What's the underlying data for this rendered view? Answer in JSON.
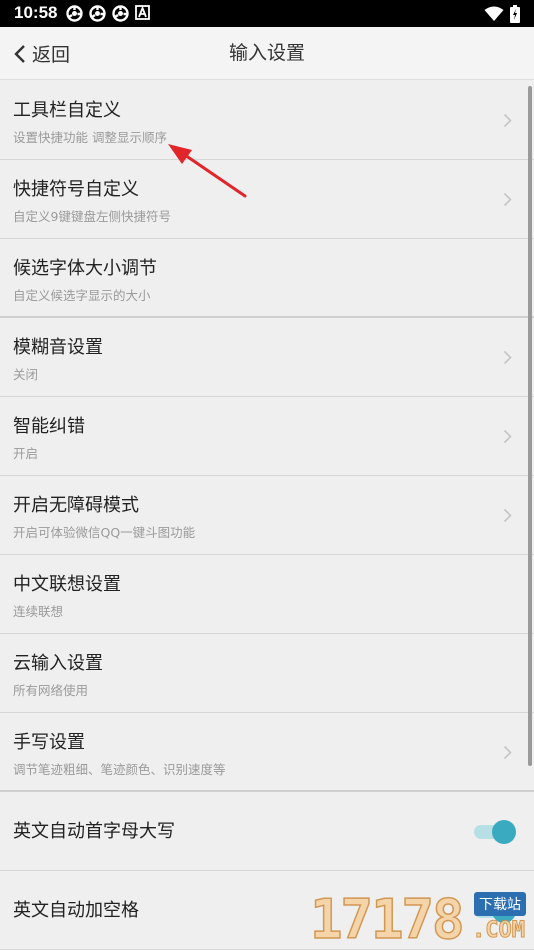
{
  "status_bar": {
    "time": "10:58",
    "icons_left": [
      "app-icon",
      "app-icon",
      "app-icon",
      "a-icon"
    ],
    "icons_right": [
      "wifi-icon",
      "battery-icon"
    ]
  },
  "header": {
    "back_label": "返回",
    "title": "输入设置"
  },
  "settings": [
    {
      "title": "工具栏自定义",
      "subtitle": "设置快捷功能 调整显示顺序",
      "control": "chevron"
    },
    {
      "title": "快捷符号自定义",
      "subtitle": "自定义9键键盘左侧快捷符号",
      "control": "chevron"
    },
    {
      "title": "候选字体大小调节",
      "subtitle": "自定义候选字显示的大小",
      "control": "none"
    },
    {
      "title": "模糊音设置",
      "subtitle": "关闭",
      "control": "chevron"
    },
    {
      "title": "智能纠错",
      "subtitle": "开启",
      "control": "chevron"
    },
    {
      "title": "开启无障碍模式",
      "subtitle": "开启可体验微信QQ一键斗图功能",
      "control": "chevron"
    },
    {
      "title": "中文联想设置",
      "subtitle": "连续联想",
      "control": "none"
    },
    {
      "title": "云输入设置",
      "subtitle": "所有网络使用",
      "control": "none"
    },
    {
      "title": "手写设置",
      "subtitle": "调节笔迹粗细、笔迹颜色、识别速度等",
      "control": "chevron"
    },
    {
      "title": "英文自动首字母大写",
      "control": "toggle",
      "toggle_on": true
    },
    {
      "title": "英文自动加空格",
      "control": "toggle",
      "toggle_on": true
    }
  ],
  "annotation": {
    "color": "#e0252b"
  },
  "watermark": {
    "digits": "17178",
    "badge": "下载站",
    "suffix": ".COM"
  },
  "colors": {
    "accent": "#3aaac0",
    "accent_track": "#b7dfe6"
  }
}
